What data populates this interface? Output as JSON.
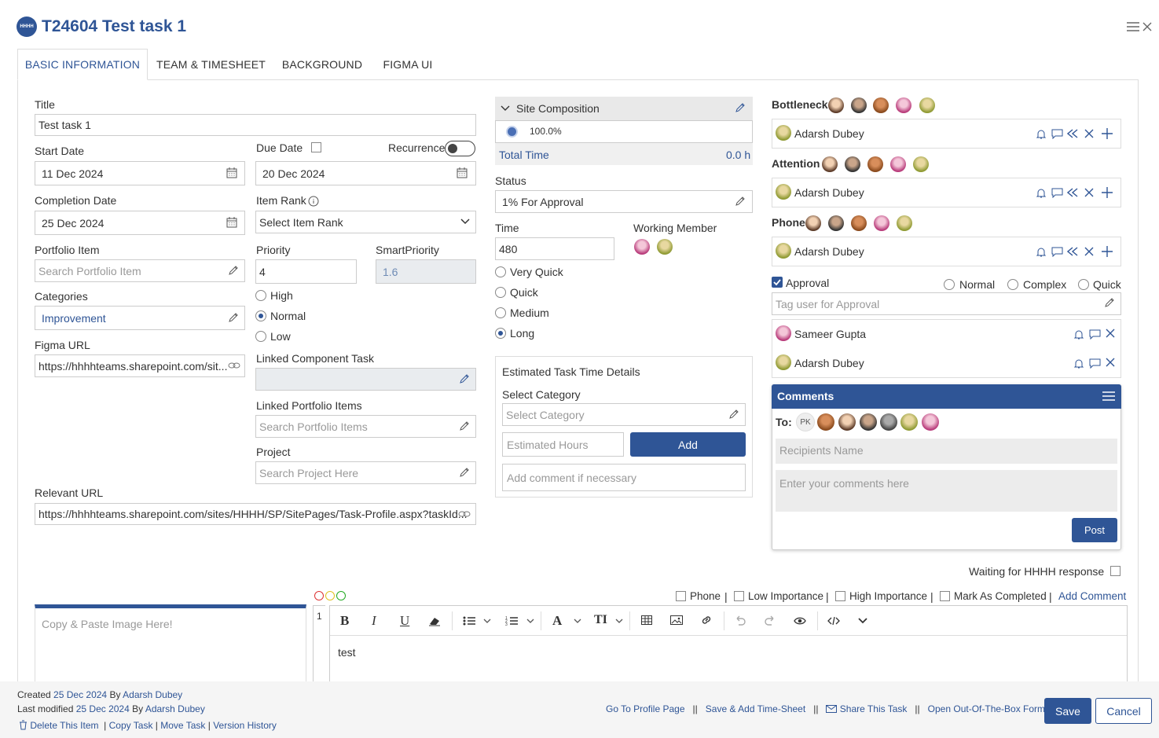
{
  "header": {
    "logo_text": "HHHH",
    "title": "T24604 Test task 1"
  },
  "tabs": [
    {
      "label": "BASIC INFORMATION"
    },
    {
      "label": "TEAM & TIMESHEET"
    },
    {
      "label": "BACKGROUND"
    },
    {
      "label": "FIGMA UI"
    }
  ],
  "form": {
    "title_label": "Title",
    "title_value": "Test task 1",
    "start_label": "Start Date",
    "start_value": "11 Dec 2024",
    "due_label": "Due Date",
    "due_value": "20 Dec 2024",
    "recurrence_label": "Recurrence",
    "completion_label": "Completion Date",
    "completion_value": "25 Dec 2024",
    "rank_label": "Item Rank",
    "rank_value": "Select Item Rank",
    "portfolio_label": "Portfolio Item",
    "portfolio_placeholder": "Search Portfolio Item",
    "priority_label": "Priority",
    "priority_value": "4",
    "smartpriority_label": "SmartPriority",
    "smartpriority_value": "1.6",
    "priority_options": [
      "High",
      "Normal",
      "Low"
    ],
    "categories_label": "Categories",
    "categories_value": "Improvement",
    "figma_label": "Figma URL",
    "figma_value": "https://hhhhteams.sharepoint.com/sit...",
    "linked_component_label": "Linked Component Task",
    "linked_portfolio_label": "Linked Portfolio Items",
    "linked_portfolio_placeholder": "Search Portfolio Items",
    "project_label": "Project",
    "project_placeholder": "Search Project Here",
    "relevant_label": "Relevant URL",
    "relevant_value": "https://hhhhteams.sharepoint.com/sites/HHHH/SP/SitePages/Task-Profile.aspx?taskId..."
  },
  "middle": {
    "site_comp_label": "Site Composition",
    "site_comp_value": "100.0%",
    "total_time_label": "Total Time",
    "total_time_value": "0.0 h",
    "status_label": "Status",
    "status_value": "1% For Approval",
    "time_label": "Time",
    "time_value": "480",
    "working_member_label": "Working Member",
    "time_options": [
      "Very Quick",
      "Quick",
      "Medium",
      "Long"
    ],
    "est_title": "Estimated Task Time Details",
    "select_category_label": "Select Category",
    "select_category_placeholder": "Select Category",
    "est_hours_placeholder": "Estimated Hours",
    "add_label": "Add",
    "comment_placeholder": "Add comment if necessary"
  },
  "right": {
    "bottleneck_label": "Bottleneck",
    "attention_label": "Attention",
    "phone_label": "Phone",
    "assignee": "Adarsh Dubey",
    "approval_label": "Approval",
    "approval_options": [
      "Normal",
      "Complex",
      "Quick"
    ],
    "approval_placeholder": "Tag user for Approval",
    "approvers": [
      "Sameer Gupta",
      "Adarsh Dubey"
    ],
    "comments_title": "Comments",
    "to_label": "To:",
    "pk_label": "PK",
    "recipients_placeholder": "Recipients Name",
    "comments_placeholder": "Enter your comments here",
    "post_label": "Post",
    "waiting_label": "Waiting for HHHH response"
  },
  "editor": {
    "paste_placeholder": "Copy & Paste Image Here!",
    "flags": [
      "Phone",
      "Low Importance",
      "High Importance",
      "Mark As Completed"
    ],
    "add_comment": "Add Comment",
    "line_no": "1",
    "content": "test"
  },
  "footer": {
    "created_prefix": "Created",
    "created_date": "25 Dec 2024",
    "by": "By",
    "created_by": "Adarsh Dubey",
    "modified_prefix": "Last modified",
    "modified_date": "25 Dec 2024",
    "modified_by": "Adarsh Dubey",
    "delete": "Delete This Item",
    "copy": "Copy Task",
    "move": "Move Task",
    "history": "Version History",
    "profile": "Go To Profile Page",
    "save_ts": "Save & Add Time-Sheet",
    "share": "Share This Task",
    "ootb": "Open Out-Of-The-Box Form",
    "save": "Save",
    "cancel": "Cancel"
  },
  "colors": {
    "accent": "#2f5596",
    "panel": "#f0f0f0",
    "border": "#ccc"
  }
}
